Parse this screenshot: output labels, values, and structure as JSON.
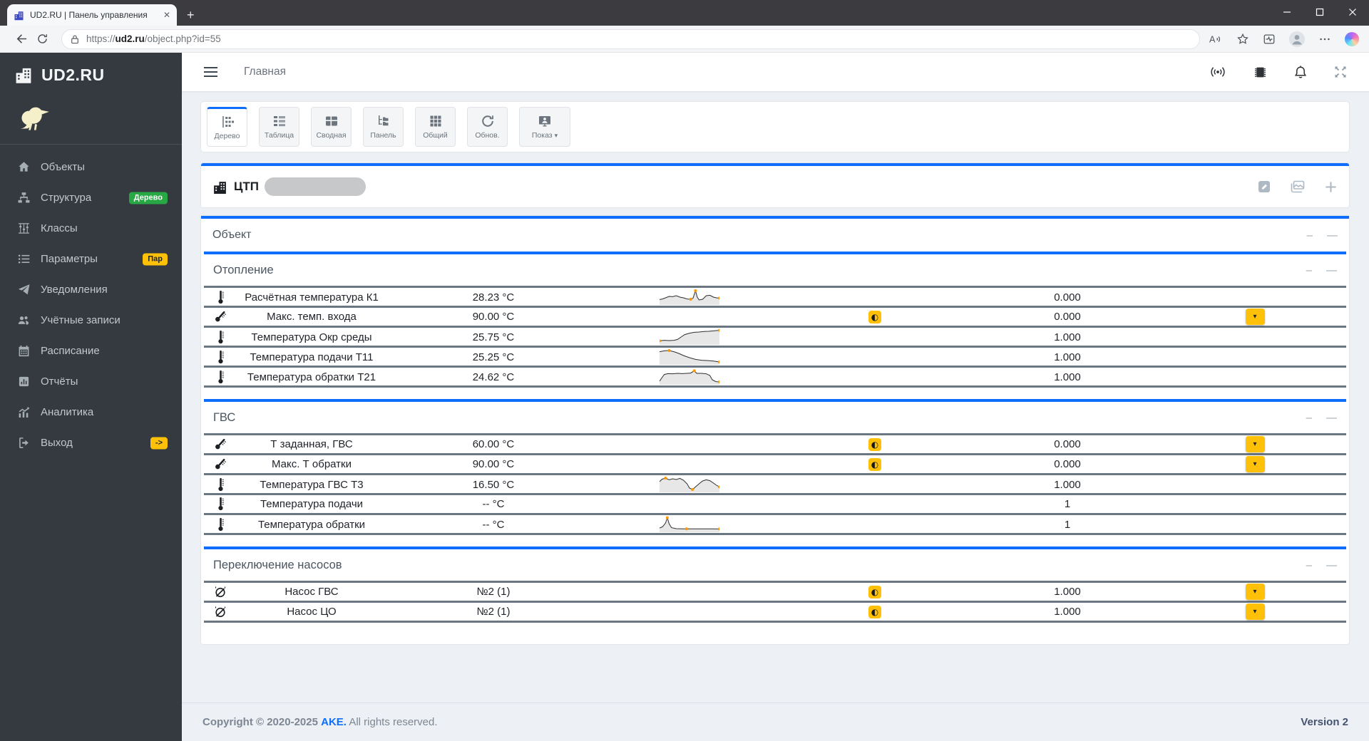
{
  "browser": {
    "tab_title": "UD2.RU | Панель управления",
    "url": {
      "scheme": "https://",
      "domain": "ud2.ru",
      "path": "/object.php?id=55"
    }
  },
  "sidebar": {
    "brand": "UD2.RU",
    "items": [
      {
        "key": "objects",
        "label": "Объекты",
        "icon": "home-icon"
      },
      {
        "key": "structure",
        "label": "Структура",
        "icon": "sitemap-icon",
        "badge": {
          "text": "Дерево",
          "color": "#28a745",
          "text_color": "#ffffff"
        }
      },
      {
        "key": "classes",
        "label": "Классы",
        "icon": "abacus-icon"
      },
      {
        "key": "parameters",
        "label": "Параметры",
        "icon": "list-icon",
        "badge": {
          "text": "Пар",
          "color": "#ffc107",
          "text_color": "#212529"
        }
      },
      {
        "key": "notifications",
        "label": "Уведомления",
        "icon": "send-icon"
      },
      {
        "key": "accounts",
        "label": "Учётные записи",
        "icon": "users-icon"
      },
      {
        "key": "schedule",
        "label": "Расписание",
        "icon": "calendar-icon"
      },
      {
        "key": "reports",
        "label": "Отчёты",
        "icon": "report-icon"
      },
      {
        "key": "analytics",
        "label": "Аналитика",
        "icon": "analytics-icon"
      },
      {
        "key": "logout",
        "label": "Выход",
        "icon": "logout-icon",
        "badge": {
          "text": "->",
          "color": "#ffc107",
          "text_color": "#212529"
        }
      }
    ]
  },
  "topbar": {
    "breadcrumb": "Главная"
  },
  "toolbar": {
    "buttons": [
      {
        "key": "tree",
        "label": "Дерево",
        "icon": "tree-icon",
        "active": true
      },
      {
        "key": "table",
        "label": "Таблица",
        "icon": "table-list-icon"
      },
      {
        "key": "pivot",
        "label": "Сводная",
        "icon": "pivot-icon"
      },
      {
        "key": "panel",
        "label": "Панель",
        "icon": "panel-icon"
      },
      {
        "key": "common",
        "label": "Общий",
        "icon": "grid-icon"
      },
      {
        "key": "refresh",
        "label": "Обнов.",
        "icon": "refresh-icon"
      },
      {
        "key": "show",
        "label": "Показ",
        "icon": "display-icon",
        "caret": true
      }
    ]
  },
  "object_header": {
    "title": "ЦТП",
    "redacted": true
  },
  "panel": {
    "title": "Объект",
    "groups": [
      {
        "title": "Отопление",
        "rows": [
          {
            "icon": "thermometer",
            "name": "Расчётная температура К1",
            "value": "28.23 °C",
            "toggle": false,
            "number": "0.000",
            "dropdown": false,
            "spark": {
              "points": [
                [
                  0,
                  0.72
                ],
                [
                  0.05,
                  0.68
                ],
                [
                  0.1,
                  0.6
                ],
                [
                  0.16,
                  0.5
                ],
                [
                  0.22,
                  0.52
                ],
                [
                  0.28,
                  0.45
                ],
                [
                  0.34,
                  0.55
                ],
                [
                  0.4,
                  0.6
                ],
                [
                  0.46,
                  0.68
                ],
                [
                  0.52,
                  0.7
                ],
                [
                  0.56,
                  0.62
                ],
                [
                  0.6,
                  0.1
                ],
                [
                  0.63,
                  0.55
                ],
                [
                  0.66,
                  0.75
                ],
                [
                  0.72,
                  0.7
                ],
                [
                  0.78,
                  0.45
                ],
                [
                  0.84,
                  0.42
                ],
                [
                  0.9,
                  0.55
                ],
                [
                  0.95,
                  0.6
                ],
                [
                  1,
                  0.62
                ]
              ],
              "dots": [
                [
                  0.6,
                  0.1
                ],
                [
                  0.52,
                  0.7
                ],
                [
                  1,
                  0.62
                ]
              ]
            }
          },
          {
            "icon": "thermometer-set",
            "name": "Макс. темп. входа",
            "value": "90.00 °C",
            "toggle": true,
            "number": "0.000",
            "dropdown": true,
            "spark": null
          },
          {
            "icon": "thermometer",
            "name": "Температура Окр среды",
            "value": "25.75 °C",
            "toggle": false,
            "number": "1.000",
            "dropdown": false,
            "spark": {
              "points": [
                [
                  0,
                  0.82
                ],
                [
                  0.08,
                  0.78
                ],
                [
                  0.16,
                  0.8
                ],
                [
                  0.24,
                  0.78
                ],
                [
                  0.3,
                  0.72
                ],
                [
                  0.36,
                  0.55
                ],
                [
                  0.42,
                  0.38
                ],
                [
                  0.5,
                  0.28
                ],
                [
                  0.58,
                  0.22
                ],
                [
                  0.66,
                  0.2
                ],
                [
                  0.74,
                  0.16
                ],
                [
                  0.82,
                  0.15
                ],
                [
                  0.9,
                  0.12
                ],
                [
                  1,
                  0.08
                ]
              ],
              "dots": [
                [
                  0,
                  0.82
                ],
                [
                  1,
                  0.08
                ]
              ]
            }
          },
          {
            "icon": "thermometer",
            "name": "Температура подачи Т11",
            "value": "25.25 °C",
            "toggle": false,
            "number": "1.000",
            "dropdown": false,
            "spark": {
              "points": [
                [
                  0,
                  0.18
                ],
                [
                  0.08,
                  0.12
                ],
                [
                  0.16,
                  0.1
                ],
                [
                  0.24,
                  0.18
                ],
                [
                  0.32,
                  0.3
                ],
                [
                  0.4,
                  0.45
                ],
                [
                  0.5,
                  0.6
                ],
                [
                  0.6,
                  0.72
                ],
                [
                  0.7,
                  0.78
                ],
                [
                  0.8,
                  0.8
                ],
                [
                  0.9,
                  0.84
                ],
                [
                  1,
                  0.9
                ]
              ],
              "dots": [
                [
                  0.16,
                  0.1
                ],
                [
                  1,
                  0.9
                ]
              ]
            }
          },
          {
            "icon": "thermometer",
            "name": "Температура обратки Т21",
            "value": "24.62 °C",
            "toggle": false,
            "number": "1.000",
            "dropdown": false,
            "spark": {
              "points": [
                [
                  0,
                  0.85
                ],
                [
                  0.04,
                  0.6
                ],
                [
                  0.08,
                  0.38
                ],
                [
                  0.14,
                  0.32
                ],
                [
                  0.22,
                  0.33
                ],
                [
                  0.3,
                  0.3
                ],
                [
                  0.38,
                  0.32
                ],
                [
                  0.46,
                  0.3
                ],
                [
                  0.52,
                  0.28
                ],
                [
                  0.58,
                  0.12
                ],
                [
                  0.62,
                  0.3
                ],
                [
                  0.7,
                  0.3
                ],
                [
                  0.78,
                  0.33
                ],
                [
                  0.84,
                  0.45
                ],
                [
                  0.88,
                  0.75
                ],
                [
                  0.94,
                  0.88
                ],
                [
                  1,
                  0.9
                ]
              ],
              "dots": [
                [
                  0.58,
                  0.12
                ],
                [
                  1,
                  0.9
                ]
              ]
            }
          }
        ]
      },
      {
        "title": "ГВС",
        "rows": [
          {
            "icon": "thermometer-set",
            "name": "Т заданная, ГВС",
            "value": "60.00 °C",
            "toggle": true,
            "number": "0.000",
            "dropdown": true,
            "spark": null
          },
          {
            "icon": "thermometer-set",
            "name": "Макс. Т обратки",
            "value": "90.00 °C",
            "toggle": true,
            "number": "0.000",
            "dropdown": true,
            "spark": null
          },
          {
            "icon": "thermometer",
            "name": "Температура ГВС Т3",
            "value": "16.50 °C",
            "toggle": false,
            "number": "1.000",
            "dropdown": false,
            "spark": {
              "points": [
                [
                  0,
                  0.35
                ],
                [
                  0.04,
                  0.18
                ],
                [
                  0.1,
                  0.1
                ],
                [
                  0.16,
                  0.22
                ],
                [
                  0.22,
                  0.15
                ],
                [
                  0.28,
                  0.2
                ],
                [
                  0.34,
                  0.12
                ],
                [
                  0.4,
                  0.25
                ],
                [
                  0.46,
                  0.5
                ],
                [
                  0.5,
                  0.8
                ],
                [
                  0.55,
                  0.9
                ],
                [
                  0.6,
                  0.72
                ],
                [
                  0.66,
                  0.5
                ],
                [
                  0.72,
                  0.3
                ],
                [
                  0.78,
                  0.22
                ],
                [
                  0.84,
                  0.28
                ],
                [
                  0.9,
                  0.45
                ],
                [
                  0.95,
                  0.6
                ],
                [
                  1,
                  0.72
                ]
              ],
              "dots": [
                [
                  0.1,
                  0.1
                ],
                [
                  0.55,
                  0.9
                ],
                [
                  1,
                  0.72
                ]
              ]
            }
          },
          {
            "icon": "thermometer",
            "name": "Температура подачи",
            "value": "-- °C",
            "toggle": false,
            "number": "1",
            "dropdown": false,
            "spark": null
          },
          {
            "icon": "thermometer",
            "name": "Температура обратки",
            "value": "-- °C",
            "toggle": false,
            "number": "1",
            "dropdown": false,
            "spark": {
              "points": [
                [
                  0,
                  0.8
                ],
                [
                  0.05,
                  0.72
                ],
                [
                  0.1,
                  0.45
                ],
                [
                  0.13,
                  0.08
                ],
                [
                  0.16,
                  0.5
                ],
                [
                  0.2,
                  0.78
                ],
                [
                  0.28,
                  0.85
                ],
                [
                  0.4,
                  0.86
                ],
                [
                  0.55,
                  0.86
                ],
                [
                  0.7,
                  0.86
                ],
                [
                  0.85,
                  0.86
                ],
                [
                  1,
                  0.87
                ]
              ],
              "dots": [
                [
                  0.13,
                  0.08
                ],
                [
                  0.45,
                  0.86
                ],
                [
                  1,
                  0.87
                ]
              ]
            }
          }
        ]
      },
      {
        "title": "Переключение насосов",
        "rows": [
          {
            "icon": "pump",
            "name": "Насос ГВС",
            "value": "№2 (1)",
            "toggle": true,
            "number": "1.000",
            "dropdown": true,
            "spark": null
          },
          {
            "icon": "pump",
            "name": "Насос ЦО",
            "value": "№2 (1)",
            "toggle": true,
            "number": "1.000",
            "dropdown": true,
            "spark": null
          }
        ]
      }
    ]
  },
  "footer": {
    "copyright_prefix": "Copyright © 2020-2025",
    "brand": "AKE.",
    "suffix": "All rights reserved.",
    "version": "Version 2"
  },
  "colors": {
    "accent": "#0d6efd",
    "control": "#ffc107",
    "badge_green": "#28a745",
    "row_divider": "#6a7682"
  }
}
